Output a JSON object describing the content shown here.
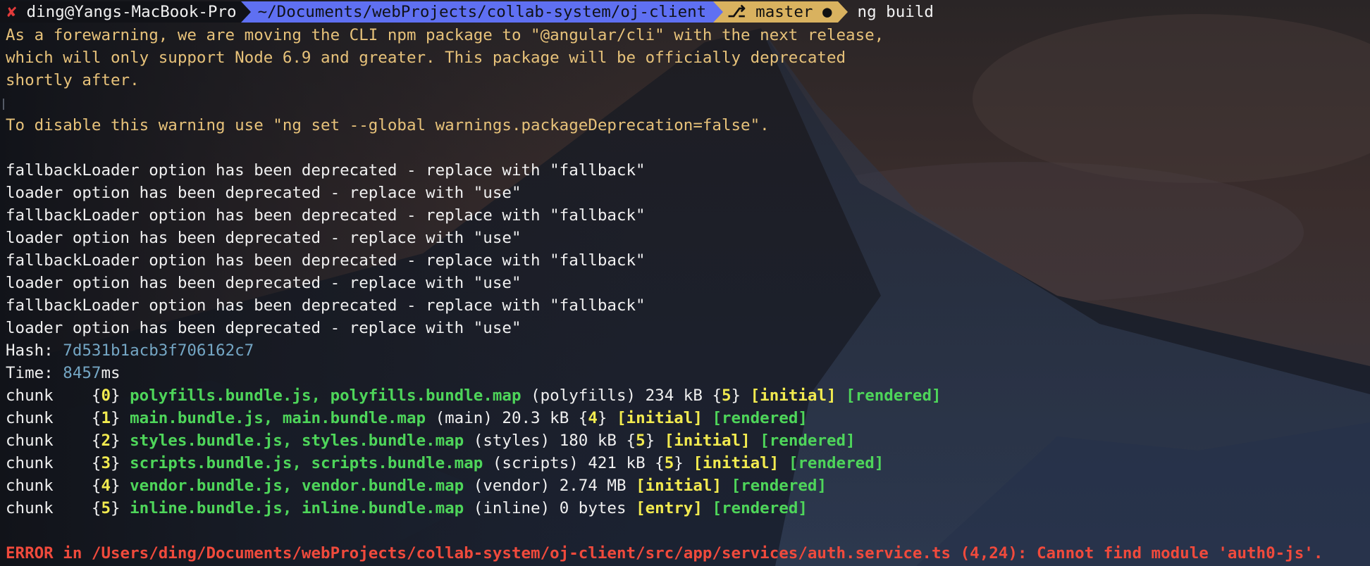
{
  "prompt": {
    "status_icon": "✘",
    "context": "ding@Yangs-MacBook-Pro",
    "path": "~/Documents/webProjects/collab-system/oj-client",
    "branch_icon": "⎇",
    "branch": "master ●",
    "command": "ng build"
  },
  "warning": {
    "line1": "As a forewarning, we are moving the CLI npm package to \"@angular/cli\" with the next release,",
    "line2": "which will only support Node 6.9 and greater. This package will be officially deprecated",
    "line3": "shortly after.",
    "line4": "To disable this warning use \"ng set --global warnings.packageDeprecation=false\"."
  },
  "deprecations": [
    "fallbackLoader option has been deprecated - replace with \"fallback\"",
    "loader option has been deprecated - replace with \"use\"",
    "fallbackLoader option has been deprecated - replace with \"fallback\"",
    "loader option has been deprecated - replace with \"use\"",
    "fallbackLoader option has been deprecated - replace with \"fallback\"",
    "loader option has been deprecated - replace with \"use\"",
    "fallbackLoader option has been deprecated - replace with \"fallback\"",
    "loader option has been deprecated - replace with \"use\""
  ],
  "hash": {
    "label": "Hash: ",
    "value": "7d531b1acb3f706162c7"
  },
  "time": {
    "label": "Time: ",
    "value": "8457",
    "unit": "ms"
  },
  "chunks": [
    {
      "label": "chunk",
      "id": "0",
      "files": "polyfills.bundle.js, polyfills.bundle.map",
      "name": "(polyfills)",
      "size": "234 kB",
      "parent": "5",
      "flag": "[initial]",
      "rendered": "[rendered]"
    },
    {
      "label": "chunk",
      "id": "1",
      "files": "main.bundle.js, main.bundle.map",
      "name": "(main)",
      "size": "20.3 kB",
      "parent": "4",
      "flag": "[initial]",
      "rendered": "[rendered]"
    },
    {
      "label": "chunk",
      "id": "2",
      "files": "styles.bundle.js, styles.bundle.map",
      "name": "(styles)",
      "size": "180 kB",
      "parent": "5",
      "flag": "[initial]",
      "rendered": "[rendered]"
    },
    {
      "label": "chunk",
      "id": "3",
      "files": "scripts.bundle.js, scripts.bundle.map",
      "name": "(scripts)",
      "size": "421 kB",
      "parent": "5",
      "flag": "[initial]",
      "rendered": "[rendered]"
    },
    {
      "label": "chunk",
      "id": "4",
      "files": "vendor.bundle.js, vendor.bundle.map",
      "name": "(vendor)",
      "size": "2.74 MB",
      "parent": "",
      "flag": "[initial]",
      "rendered": "[rendered]"
    },
    {
      "label": "chunk",
      "id": "5",
      "files": "inline.bundle.js, inline.bundle.map",
      "name": "(inline)",
      "size": "0 bytes",
      "parent": "",
      "flag": "[entry]",
      "rendered": "[rendered]"
    }
  ],
  "error": "ERROR in /Users/ding/Documents/webProjects/collab-system/oj-client/src/app/services/auth.service.ts (4,24): Cannot find module 'auth0-js'.",
  "colors": {
    "warning": "#e7c27a",
    "chunk_files": "#4ed55a",
    "chunk_flags": "#f2ea4f",
    "hash_value": "#74a6c4",
    "error": "#f04a3c",
    "path_segment": "#5f70f2",
    "git_segment": "#d9b25f"
  }
}
